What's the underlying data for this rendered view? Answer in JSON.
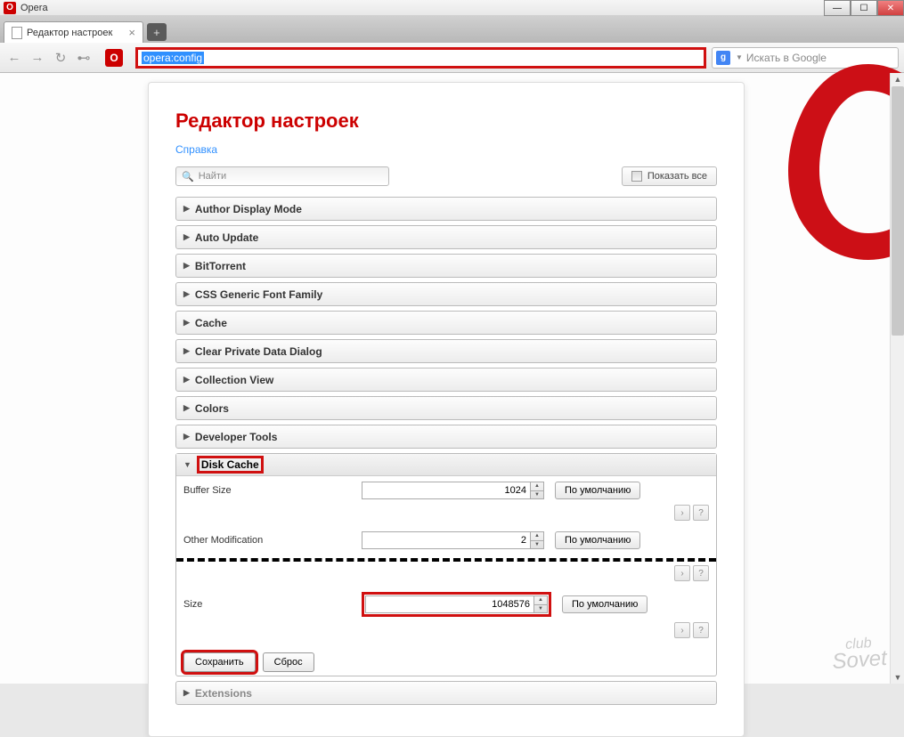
{
  "window": {
    "title": "Opera"
  },
  "tab": {
    "title": "Редактор настроек"
  },
  "url": "opera:config",
  "search_placeholder": "Искать в Google",
  "page": {
    "heading": "Редактор настроек",
    "help": "Справка",
    "find_placeholder": "Найти",
    "show_all": "Показать все"
  },
  "sections": [
    "Author Display Mode",
    "Auto Update",
    "BitTorrent",
    "CSS Generic Font Family",
    "Cache",
    "Clear Private Data Dialog",
    "Collection View",
    "Colors",
    "Developer Tools"
  ],
  "disk_cache": {
    "title": "Disk Cache",
    "rows": [
      {
        "label": "Buffer Size",
        "value": "1024"
      },
      {
        "label": "Other Modification",
        "value": "2"
      },
      {
        "label": "Size",
        "value": "1048576"
      }
    ],
    "default_btn": "По умолчанию",
    "save": "Сохранить",
    "reset": "Сброс"
  },
  "extensions": "Extensions",
  "watermark": {
    "top": "club",
    "bottom": "Sovet"
  }
}
